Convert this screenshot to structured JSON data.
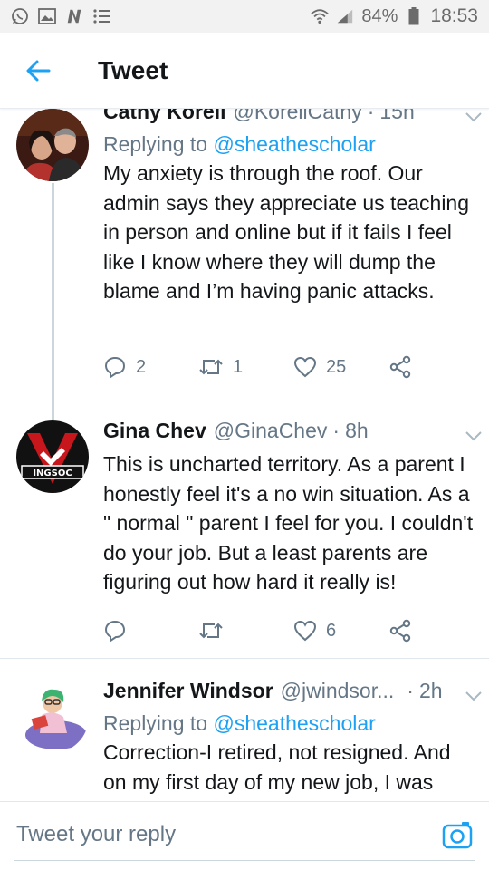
{
  "status_bar": {
    "battery": "84%",
    "time": "18:53",
    "icons": [
      "whatsapp-icon",
      "image-icon",
      "n-icon",
      "list-icon",
      "wifi-icon",
      "signal-icon",
      "battery-icon"
    ]
  },
  "header": {
    "title": "Tweet",
    "back_icon": "back-arrow-icon"
  },
  "tweets": [
    {
      "name": "Cathy Korell",
      "handle": "@KorellCathy",
      "time": "15h",
      "replying_prefix": "Replying to ",
      "replying_to": "@sheathescholar",
      "text": "My anxiety is through the roof. Our admin says they appreciate us teaching in person and online but if it fails I feel like I know where they will dump the blame and I’m having panic attacks.",
      "replies": "2",
      "retweets": "1",
      "likes": "25"
    },
    {
      "name": "Gina Chev",
      "handle": "@GinaChev",
      "time": "8h",
      "text": "This is uncharted territory. As a parent I honestly feel it's a no win situation. As a \" normal \" parent I feel for you. I couldn't do your job. But a least parents are figuring out how hard it really is!",
      "replies": "",
      "retweets": "",
      "likes": "6",
      "avatar_text": "INGSOC"
    },
    {
      "name": "Jennifer Windsor",
      "handle": "@jwindsor...",
      "time": "2h",
      "replying_prefix": "Replying to ",
      "replying_to": "@sheathescholar",
      "text": "Correction-I retired, not resigned.  And on my first day of my new job, I was"
    }
  ],
  "reply_bar": {
    "placeholder": "Tweet your reply",
    "camera_icon": "camera-icon"
  },
  "colors": {
    "accent": "#1da1f2",
    "secondary_text": "#657786",
    "primary_text": "#14171a"
  }
}
